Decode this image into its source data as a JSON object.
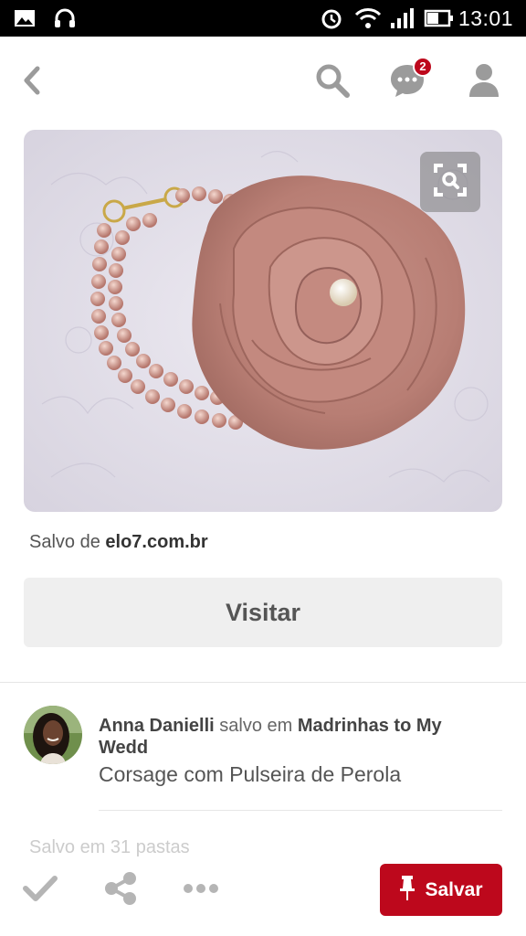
{
  "status_bar": {
    "time": "13:01",
    "icons": [
      "gallery-icon",
      "headphones-icon",
      "alarm-icon",
      "wifi-icon",
      "signal-icon",
      "battery-icon"
    ]
  },
  "header": {
    "icons": [
      "back-icon",
      "search-icon",
      "messages-icon",
      "profile-icon"
    ],
    "notification_count": "2"
  },
  "pin": {
    "image_description": "pink satin rose corsage with pearl bracelet",
    "saved_from_prefix": "Salvo de",
    "saved_from_domain": "elo7.com.br",
    "visit_label": "Visitar"
  },
  "pinner": {
    "name": "Anna Danielli",
    "action": "salvo em",
    "board": "Madrinhas to My Wedd",
    "description": "Corsage com Pulseira de Perola"
  },
  "saves_count_text": "Salvo em 31 pastas",
  "bottom_bar": {
    "icons": [
      "check-icon",
      "share-icon",
      "more-icon"
    ],
    "save_label": "Salvar"
  },
  "colors": {
    "brand_red": "#bd081c",
    "badge_red": "#bd081c",
    "icon_gray": "#9b9b9b"
  }
}
